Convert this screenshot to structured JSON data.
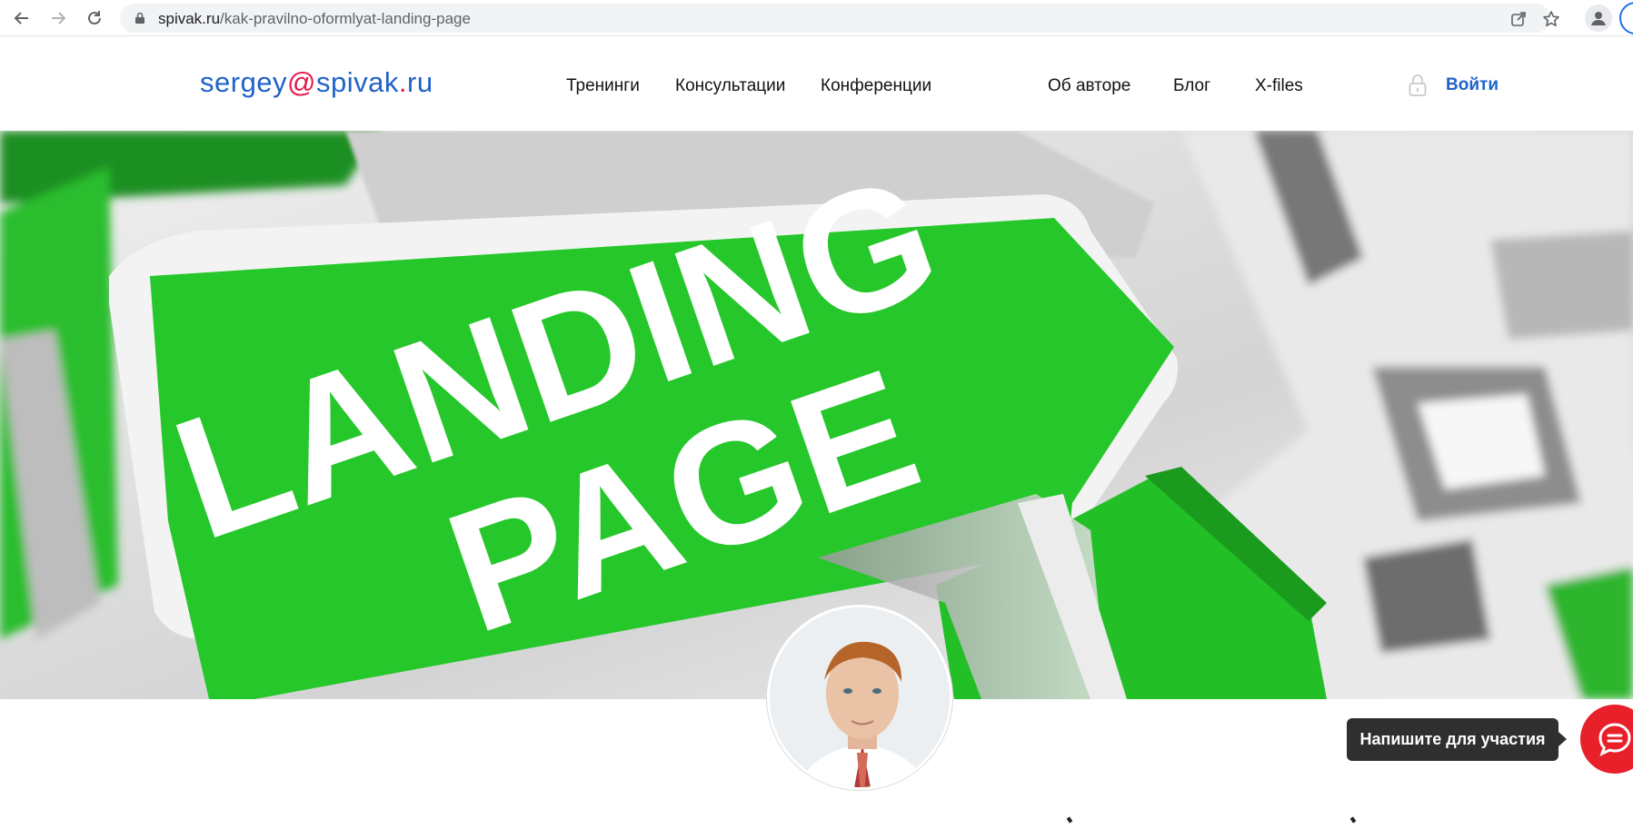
{
  "browser": {
    "url_domain": "spivak.ru",
    "url_path": "/kak-pravilno-oformlyat-landing-page",
    "icons": [
      "back-arrow-icon",
      "forward-arrow-icon",
      "reload-icon",
      "lock-icon",
      "share-icon",
      "star-icon",
      "profile-icon"
    ]
  },
  "header": {
    "logo": {
      "user": "sergey",
      "at": "@",
      "domain": "spivak",
      "dot": ".",
      "tld": "ru"
    },
    "menu": [
      {
        "label": "Тренинги"
      },
      {
        "label": "Консультации"
      },
      {
        "label": "Конференции"
      },
      {
        "label": "Об авторе"
      },
      {
        "label": "Блог"
      },
      {
        "label": "X-files"
      }
    ],
    "login_label": "Войти"
  },
  "hero": {
    "line1": "LANDING",
    "line2": "PAGE",
    "colors": {
      "green": "#25c72a",
      "white": "#ffffff",
      "grey": "#bdbdbd"
    }
  },
  "chat": {
    "tooltip": "Напишите для участия",
    "color": "#e8202a"
  }
}
